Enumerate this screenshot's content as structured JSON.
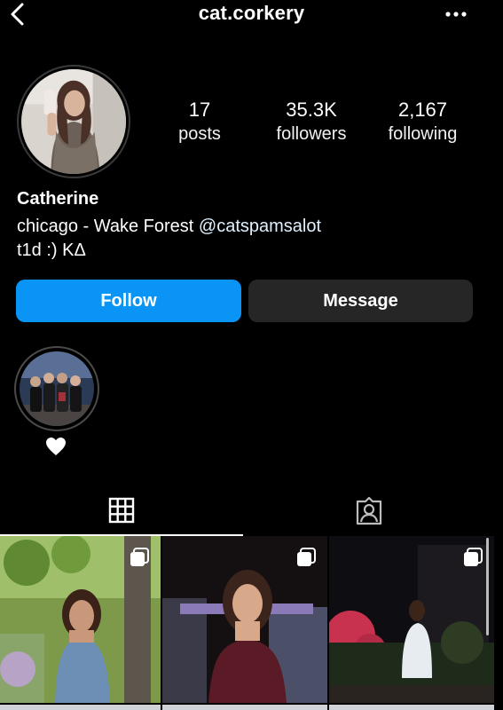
{
  "header": {
    "username": "cat.corkery",
    "back_icon": "chevron-left-icon",
    "more_icon": "more-horizontal-icon"
  },
  "profile": {
    "stats": {
      "posts_count": "17",
      "posts_label": "posts",
      "followers_count": "35.3K",
      "followers_label": "followers",
      "following_count": "2,167",
      "following_label": "following"
    },
    "name": "Catherine",
    "bio_line1_text": "chicago - Wake Forest ",
    "bio_line1_mention": "@catspamsalot",
    "bio_line2": "t1d :) ΚΔ"
  },
  "actions": {
    "follow_label": "Follow",
    "message_label": "Message"
  },
  "highlights": [
    {
      "label_icon": "heart-icon"
    }
  ],
  "tabs": [
    {
      "icon": "grid-icon",
      "active": true
    },
    {
      "icon": "tagged-person-icon",
      "active": false
    }
  ],
  "colors": {
    "background": "#000000",
    "follow_button": "#0a95f6",
    "message_button": "#262626",
    "text": "#ffffff"
  }
}
